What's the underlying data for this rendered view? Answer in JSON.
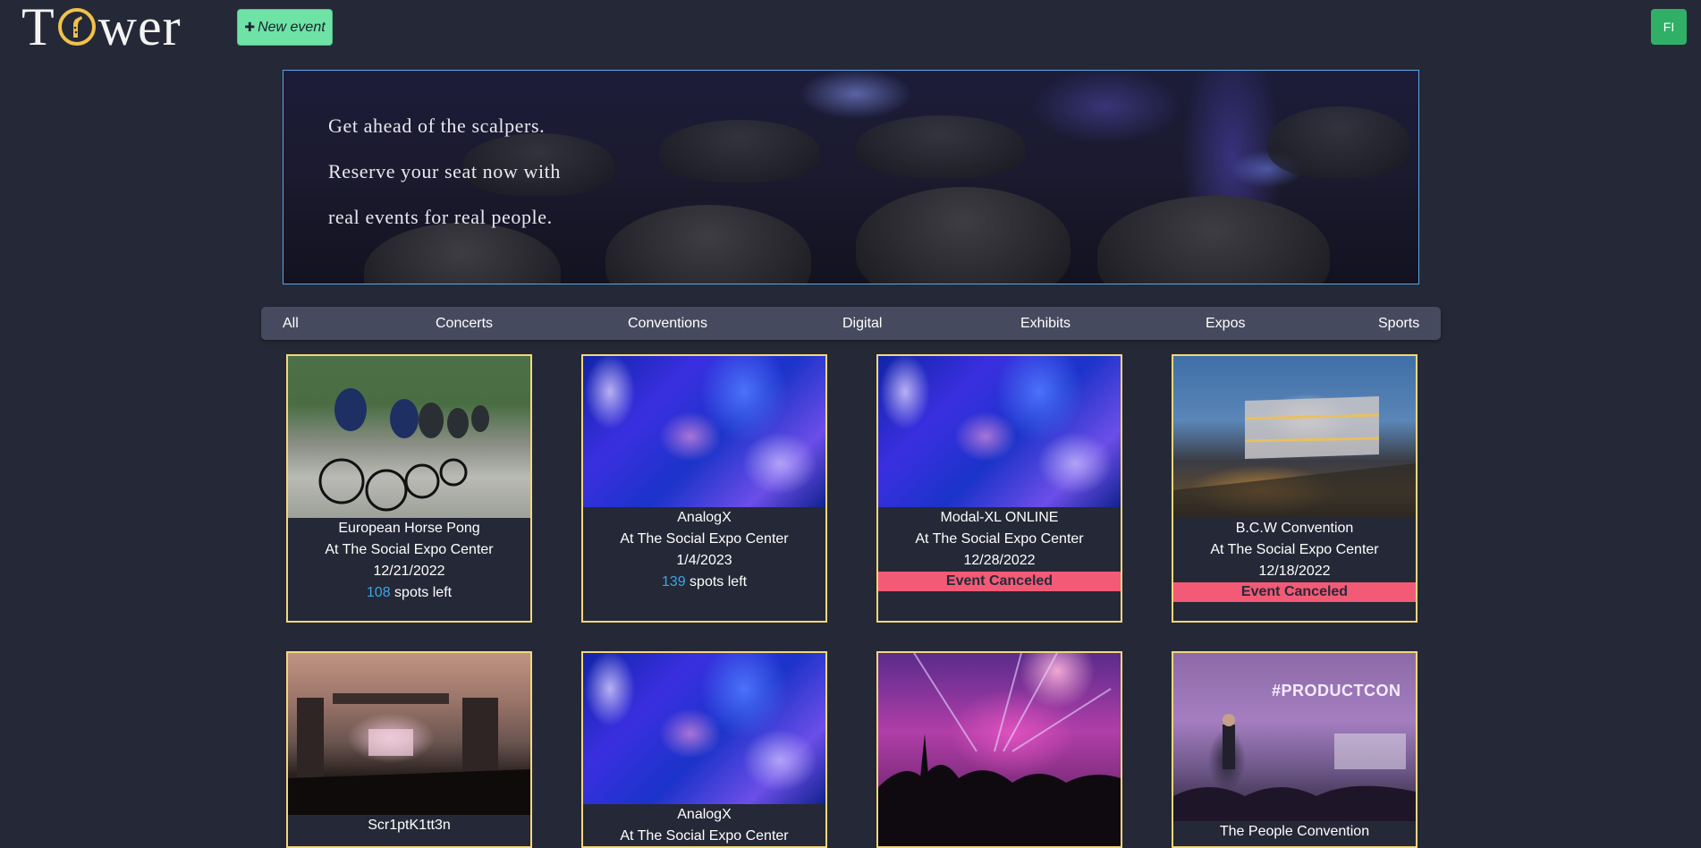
{
  "header": {
    "logo_text": "Tower",
    "new_event_label": "New event",
    "avatar_initials": "FI"
  },
  "hero": {
    "lines": [
      "Get ahead of the scalpers.",
      "Reserve your seat now with",
      "real events for real people."
    ]
  },
  "categories": [
    "All",
    "Concerts",
    "Conventions",
    "Digital",
    "Exhibits",
    "Expos",
    "Sports"
  ],
  "events": [
    {
      "name": "European Horse Pong",
      "location": "At The Social Expo Center",
      "date": "12/21/2022",
      "spots": "108",
      "spots_suffix": " spots left",
      "canceled_label": "",
      "image": "cycling-race"
    },
    {
      "name": "AnalogX",
      "location": "At The Social Expo Center",
      "date": "1/4/2023",
      "spots": "139",
      "spots_suffix": " spots left",
      "canceled_label": "",
      "image": "abstract-blue"
    },
    {
      "name": "Modal-XL ONLINE",
      "location": "At The Social Expo Center",
      "date": "12/28/2022",
      "canceled_label": "Event Canceled",
      "image": "abstract-blue"
    },
    {
      "name": "B.C.W Convention",
      "location": "At The Social Expo Center",
      "date": "12/18/2022",
      "canceled_label": "Event Canceled",
      "image": "convention-building"
    },
    {
      "name": "Scr1ptK1tt3n",
      "image": "outdoor-stage"
    },
    {
      "name": "AnalogX",
      "location": "At The Social Expo Center",
      "image": "abstract-blue"
    },
    {
      "name": "",
      "image": "concert-crowd"
    },
    {
      "name": "The People Convention",
      "image": "product-con-stage",
      "image_banner": "#PRODUCTCON"
    }
  ],
  "colors": {
    "background": "#252836",
    "card_border": "#f4d77a",
    "canceled_bg": "#f25a76",
    "spots_number": "#38a7ea",
    "new_event_btn": "#6ee3a5",
    "avatar_btn": "#2fb066",
    "nav_bg": "#454a5f"
  }
}
